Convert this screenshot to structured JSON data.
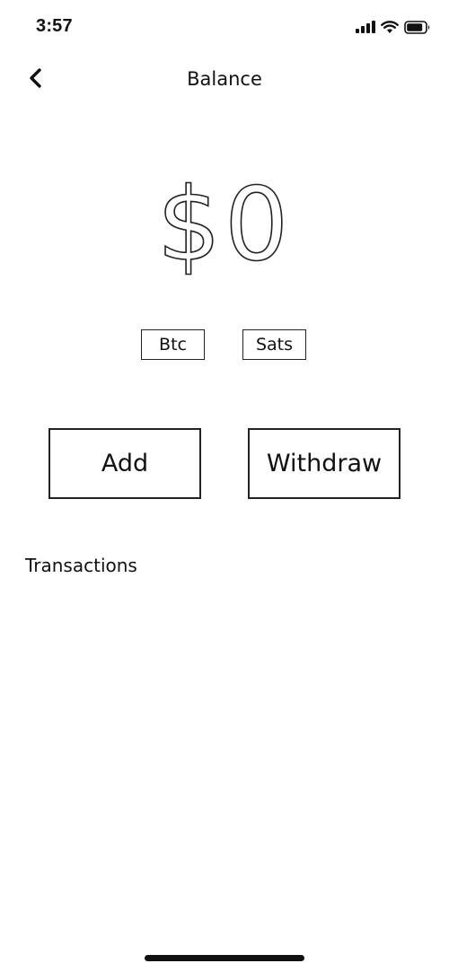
{
  "status_bar": {
    "time": "3:57",
    "icons": [
      "cellular-signal-icon",
      "wifi-icon",
      "battery-icon"
    ]
  },
  "nav": {
    "back_icon": "chevron-left-icon",
    "title": "Balance"
  },
  "balance": {
    "amount": "$0"
  },
  "units": {
    "btc_label": "Btc",
    "sats_label": "Sats"
  },
  "actions": {
    "add_label": "Add",
    "withdraw_label": "Withdraw"
  },
  "transactions": {
    "heading": "Transactions",
    "items": []
  },
  "colors": {
    "ink": "#111111",
    "background": "#ffffff"
  }
}
